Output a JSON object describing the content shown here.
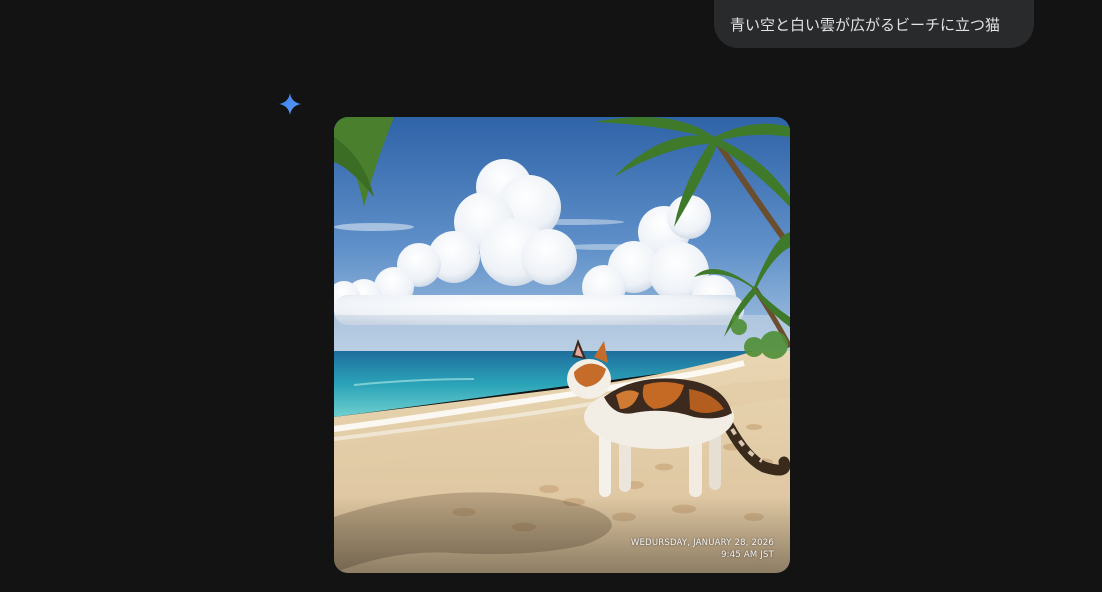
{
  "user_message": {
    "text": "青い空と白い雲が広がるビーチに立つ猫"
  },
  "assistant": {
    "icon": "gemini-spark-icon",
    "generated_image": {
      "alt": "青い空と白い雲が広がるビーチに立つ猫",
      "watermark_date": "WEDURSDAY, JANUARY 28, 2026",
      "watermark_time": "9:45 AM JST"
    }
  },
  "colors": {
    "background": "#131313",
    "bubble": "#282a2c",
    "bubble_text": "#e3e3e3",
    "spark_blue": "#4a8af4"
  }
}
